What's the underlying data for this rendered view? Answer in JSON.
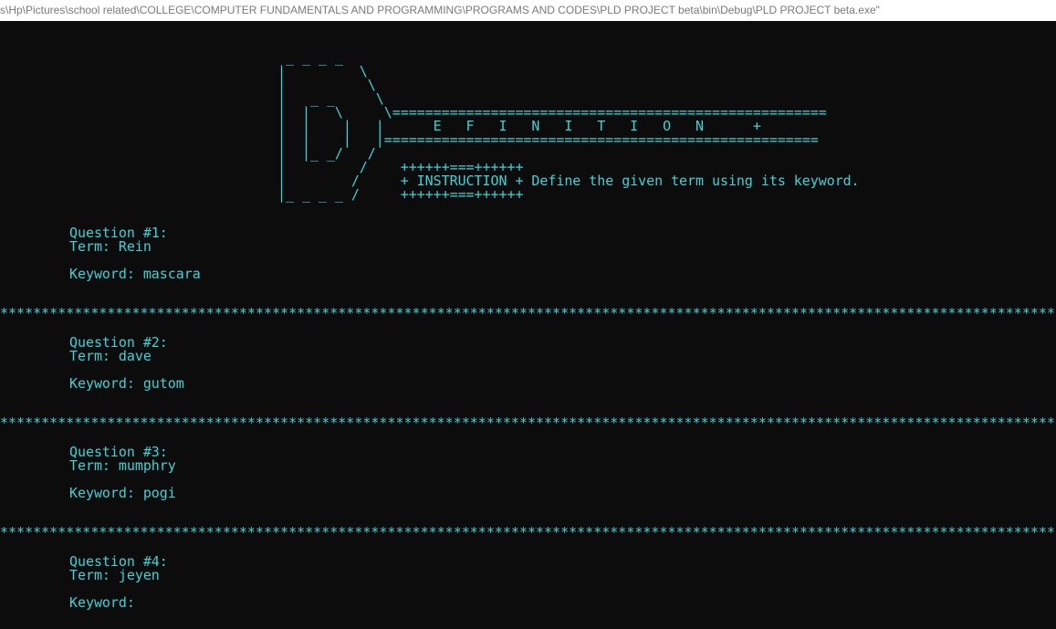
{
  "window": {
    "title": "s\\Hp\\Pictures\\school related\\COLLEGE\\COMPUTER FUNDAMENTALS AND PROGRAMMING\\PROGRAMS AND CODES\\PLD PROJECT beta\\bin\\Debug\\PLD PROJECT beta.exe\""
  },
  "theme": {
    "background": "#0c0c0c",
    "text_color": "#3fd2d6",
    "titlebar_background": "#ffffff",
    "titlebar_text": "#7a7a7a"
  },
  "banner": {
    "art": " _ _ _ _\n|         \\\n|          \\\n|   _ _     \\\n|  |   \\     \\=====================================================\n|  |    |   |      E   F   I   N   I   T   I   O   N      +\n|  |    |   |=====================================================\n|  |_ _/   /\n|         /    ++++++===++++++\n|        /     + INSTRUCTION + Define the given term using its keyword.\n|_ _ _ _ /     ++++++===++++++"
  },
  "separator": "************************************************************************************************************************************************************",
  "questions": [
    {
      "number_line": "Question #1:",
      "term_line": "Term: Rein",
      "keyword_line": "Keyword: mascara"
    },
    {
      "number_line": "Question #2:",
      "term_line": "Term: dave",
      "keyword_line": "Keyword: gutom"
    },
    {
      "number_line": "Question #3:",
      "term_line": "Term: mumphry",
      "keyword_line": "Keyword: pogi"
    },
    {
      "number_line": "Question #4:",
      "term_line": "Term: jeyen",
      "keyword_line": "Keyword: "
    }
  ]
}
